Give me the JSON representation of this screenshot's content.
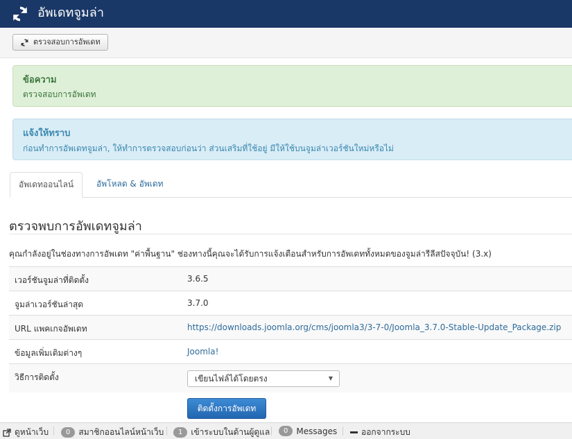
{
  "header": {
    "title": "อัพเดทจูมล่า",
    "icon": "refresh-icon",
    "bg_color": "#1a3867"
  },
  "toolbar": {
    "check_label": "ตรวจสอบการอัพเดท",
    "check_icon": "refresh-icon"
  },
  "alerts": {
    "message": {
      "heading": "ข้อความ",
      "text": "ตรวจสอบการอัพเดท"
    },
    "notice": {
      "heading": "แจ้งให้ทราบ",
      "text": "ก่อนทำการอัพเดทจูมล่า, ให้ทำการตรวจสอบก่อนว่า ส่วนเสริมที่ใช้อยู่ มีให้ใช้บนจูมล่าเวอร์ชันใหม่หรือไม่"
    }
  },
  "tabs": [
    {
      "label": "อัพเดทออนไลน์",
      "active": true
    },
    {
      "label": "อัพโหลด & อัพเดท",
      "active": false
    }
  ],
  "main": {
    "title": "ตรวจพบการอัพเดทจูมล่า",
    "description": "คุณกำลังอยู่ในช่องทางการอัพเดท \"ค่าพื้นฐาน\" ช่องทางนี้คุณจะได้รับการแจ้งเตือนสำหรับการอัพเดททั้งหมดของจูมล่ารีลีสปัจจุบัน! (3.x)",
    "rows": [
      {
        "key": "เวอร์ชันจูมล่าที่ติดตั้ง",
        "value": "3.6.5"
      },
      {
        "key": "จูมล่าเวอร์ชันล่าสุด",
        "value": "3.7.0"
      },
      {
        "key": "URL แพคเกจอัพเดท",
        "value": "https://downloads.joomla.org/cms/joomla3/3-7-0/Joomla_3.7.0-Stable-Update_Package.zip"
      },
      {
        "key": "ข้อมูลเพิ่มเติมต่างๆ",
        "value": "Joomla!"
      },
      {
        "key": "วิธีการติดตั้ง",
        "value": "เขียนไฟล์ได้โดยตรง"
      }
    ],
    "install_button": "ติดตั้งการอัพเดท"
  },
  "statusbar": {
    "view_site": "ดูหน้าเว็บ",
    "online_members_count": "0",
    "online_members_label": "สมาชิกออนไลน์หน้าเว็บ",
    "admin_count": "1",
    "admin_label": "เข้าระบบในด้านผู้ดูแล",
    "messages_count": "0",
    "messages_label": "Messages",
    "logout": "ออกจากระบบ"
  }
}
